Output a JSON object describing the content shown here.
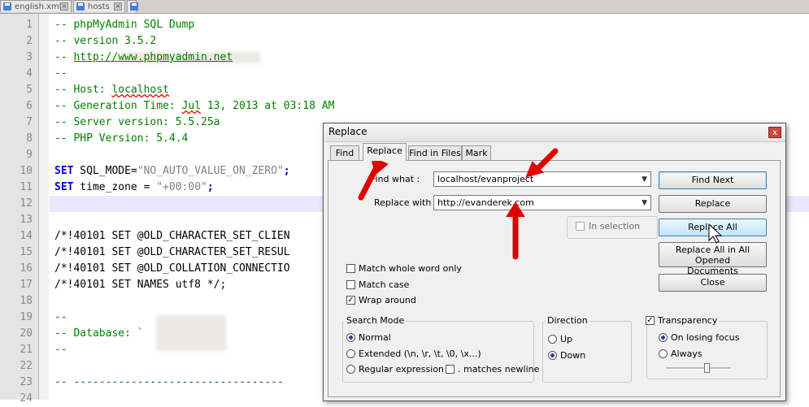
{
  "editor": {
    "tabs": [
      {
        "label": "english.xml"
      },
      {
        "label": "hosts"
      }
    ],
    "lines": [
      {
        "n": "1",
        "text": "-- phpMyAdmin SQL Dump"
      },
      {
        "n": "2",
        "text": "-- version 3.5.2"
      },
      {
        "n": "3",
        "prefix": "-- ",
        "link": "http://www.phpmyadmin.net"
      },
      {
        "n": "4",
        "text": "--"
      },
      {
        "n": "5",
        "prefix": "-- Host: ",
        "underlined": "localhost"
      },
      {
        "n": "6",
        "prefix": "-- Generation Time: ",
        "underlined": "Jul",
        "suffix": " 13, 2013 at 03:18 AM"
      },
      {
        "n": "7",
        "text": "-- Server version: 5.5.25a"
      },
      {
        "n": "8",
        "text": "-- PHP Version: 5.4.4"
      },
      {
        "n": "9",
        "text": ""
      },
      {
        "n": "10",
        "kw": "SET",
        "rest": " SQL_MODE=",
        "str": "\"NO_AUTO_VALUE_ON_ZERO\"",
        "end": ";"
      },
      {
        "n": "11",
        "kw": "SET",
        "rest": " time_zone = ",
        "str": "\"+00:00\"",
        "end": ";"
      },
      {
        "n": "12",
        "text": ""
      },
      {
        "n": "13",
        "text": ""
      },
      {
        "n": "14",
        "text": "/*!40101 SET @OLD_CHARACTER_SET_CLIEN"
      },
      {
        "n": "15",
        "text": "/*!40101 SET @OLD_CHARACTER_SET_RESUL"
      },
      {
        "n": "16",
        "text": "/*!40101 SET @OLD_COLLATION_CONNECTIO"
      },
      {
        "n": "17",
        "text": "/*!40101 SET NAMES utf8 */;"
      },
      {
        "n": "18",
        "text": ""
      },
      {
        "n": "19",
        "text": "--"
      },
      {
        "n": "20",
        "text": "-- Database: `"
      },
      {
        "n": "21",
        "text": "--"
      },
      {
        "n": "22",
        "text": ""
      },
      {
        "n": "23",
        "text": "-- ---------------------------------"
      },
      {
        "n": "24",
        "text": ""
      }
    ]
  },
  "dialog": {
    "title": "Replace",
    "close_label": "x",
    "tabs": [
      {
        "label": "Find"
      },
      {
        "label": "Replace"
      },
      {
        "label": "Find in Files"
      },
      {
        "label": "Mark"
      }
    ],
    "find_what_label": "Find what :",
    "find_what_value": "localhost/evanproject",
    "replace_with_label": "Replace with :",
    "replace_with_value": "http://evanderek.com",
    "in_selection_label": "In selection",
    "buttons": {
      "find_next": "Find Next",
      "replace": "Replace",
      "replace_all": "Replace All",
      "replace_all_opened_1": "Replace All in All Opened",
      "replace_all_opened_2": "Documents",
      "close": "Close"
    },
    "options": {
      "match_whole_word": "Match whole word only",
      "match_case": "Match case",
      "wrap_around": "Wrap around"
    },
    "search_mode": {
      "title": "Search Mode",
      "normal": "Normal",
      "extended": "Extended (\\n, \\r, \\t, \\0, \\x...)",
      "regex": "Regular expression",
      "matches_newline": ". matches newline"
    },
    "direction": {
      "title": "Direction",
      "up": "Up",
      "down": "Down"
    },
    "transparency": {
      "title": "Transparency",
      "on_losing_focus": "On losing focus",
      "always": "Always"
    }
  },
  "colors": {
    "comment": "#008000",
    "keyword": "#0000cc",
    "string": "#808080",
    "annotation_arrow": "#e00000"
  }
}
